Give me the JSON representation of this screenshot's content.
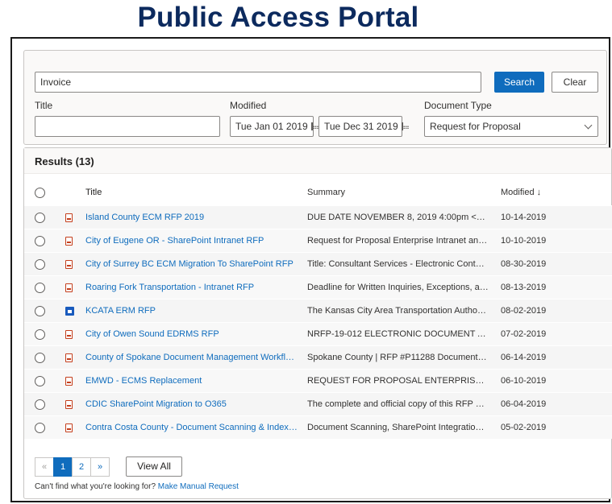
{
  "page": {
    "title": "Public Access Portal"
  },
  "search": {
    "keyword_value": "Invoice",
    "search_label": "Search",
    "clear_label": "Clear",
    "title_label": "Title",
    "title_value": "",
    "modified_label": "Modified",
    "date_from": "Tue Jan 01 2019",
    "date_to": "Tue Dec 31 2019",
    "doctype_label": "Document Type",
    "doctype_value": "Request for Proposal"
  },
  "results": {
    "heading": "Results (13)",
    "columns": {
      "title": "Title",
      "summary": "Summary",
      "modified": "Modified ↓"
    },
    "rows": [
      {
        "title": "Island County ECM RFP 2019",
        "summary": "DUE DATE NOVEMBER 8, 2019 4:00pm <ddd/...",
        "modified": "10-14-2019",
        "icon": "pdf-icon"
      },
      {
        "title": "City of Eugene OR - SharePoint Intranet RFP",
        "summary": "Request for Proposal Enterprise Intranet and In...",
        "modified": "10-10-2019",
        "icon": "pdf-icon"
      },
      {
        "title": "City of Surrey BC ECM Migration To SharePoint RFP",
        "summary": "Title: Consultant Services - Electronic Content ...",
        "modified": "08-30-2019",
        "icon": "pdf-icon"
      },
      {
        "title": "Roaring Fork Transportation - Intranet RFP",
        "summary": "Deadline for Written Inquiries, Exceptions, and...",
        "modified": "08-13-2019",
        "icon": "pdf-icon"
      },
      {
        "title": "KCATA ERM RFP",
        "summary": "The Kansas City Area Transportation Authority ...",
        "modified": "08-02-2019",
        "icon": "word-icon"
      },
      {
        "title": "City of Owen Sound EDRMS RFP",
        "summary": "NRFP-19-012 ELECTRONIC DOCUMENT AND ...",
        "modified": "07-02-2019",
        "icon": "pdf-icon"
      },
      {
        "title": "County of Spokane Document Management Workflow ...",
        "summary": "Spokane County | RFP #P11288 Document Ma...",
        "modified": "06-14-2019",
        "icon": "pdf-icon"
      },
      {
        "title": "EMWD - ECMS Replacement",
        "summary": "REQUEST FOR PROPOSAL    ENTERPRISE CON...",
        "modified": "06-10-2019",
        "icon": "pdf-icon"
      },
      {
        "title": "CDIC SharePoint Migration to O365",
        "summary": "The complete and official copy of this RFP #20...",
        "modified": "06-04-2019",
        "icon": "pdf-icon"
      },
      {
        "title": "Contra Costa County - Document Scanning & Indexing...",
        "summary": "Document Scanning, SharePoint Integration an...",
        "modified": "05-02-2019",
        "icon": "pdf-icon"
      }
    ]
  },
  "pager": {
    "prev": "«",
    "pages": [
      "1",
      "2"
    ],
    "next": "»",
    "view_all": "View All"
  },
  "footer": {
    "help_text": "Can't find what you're looking for? ",
    "help_link": "Make Manual Request"
  }
}
